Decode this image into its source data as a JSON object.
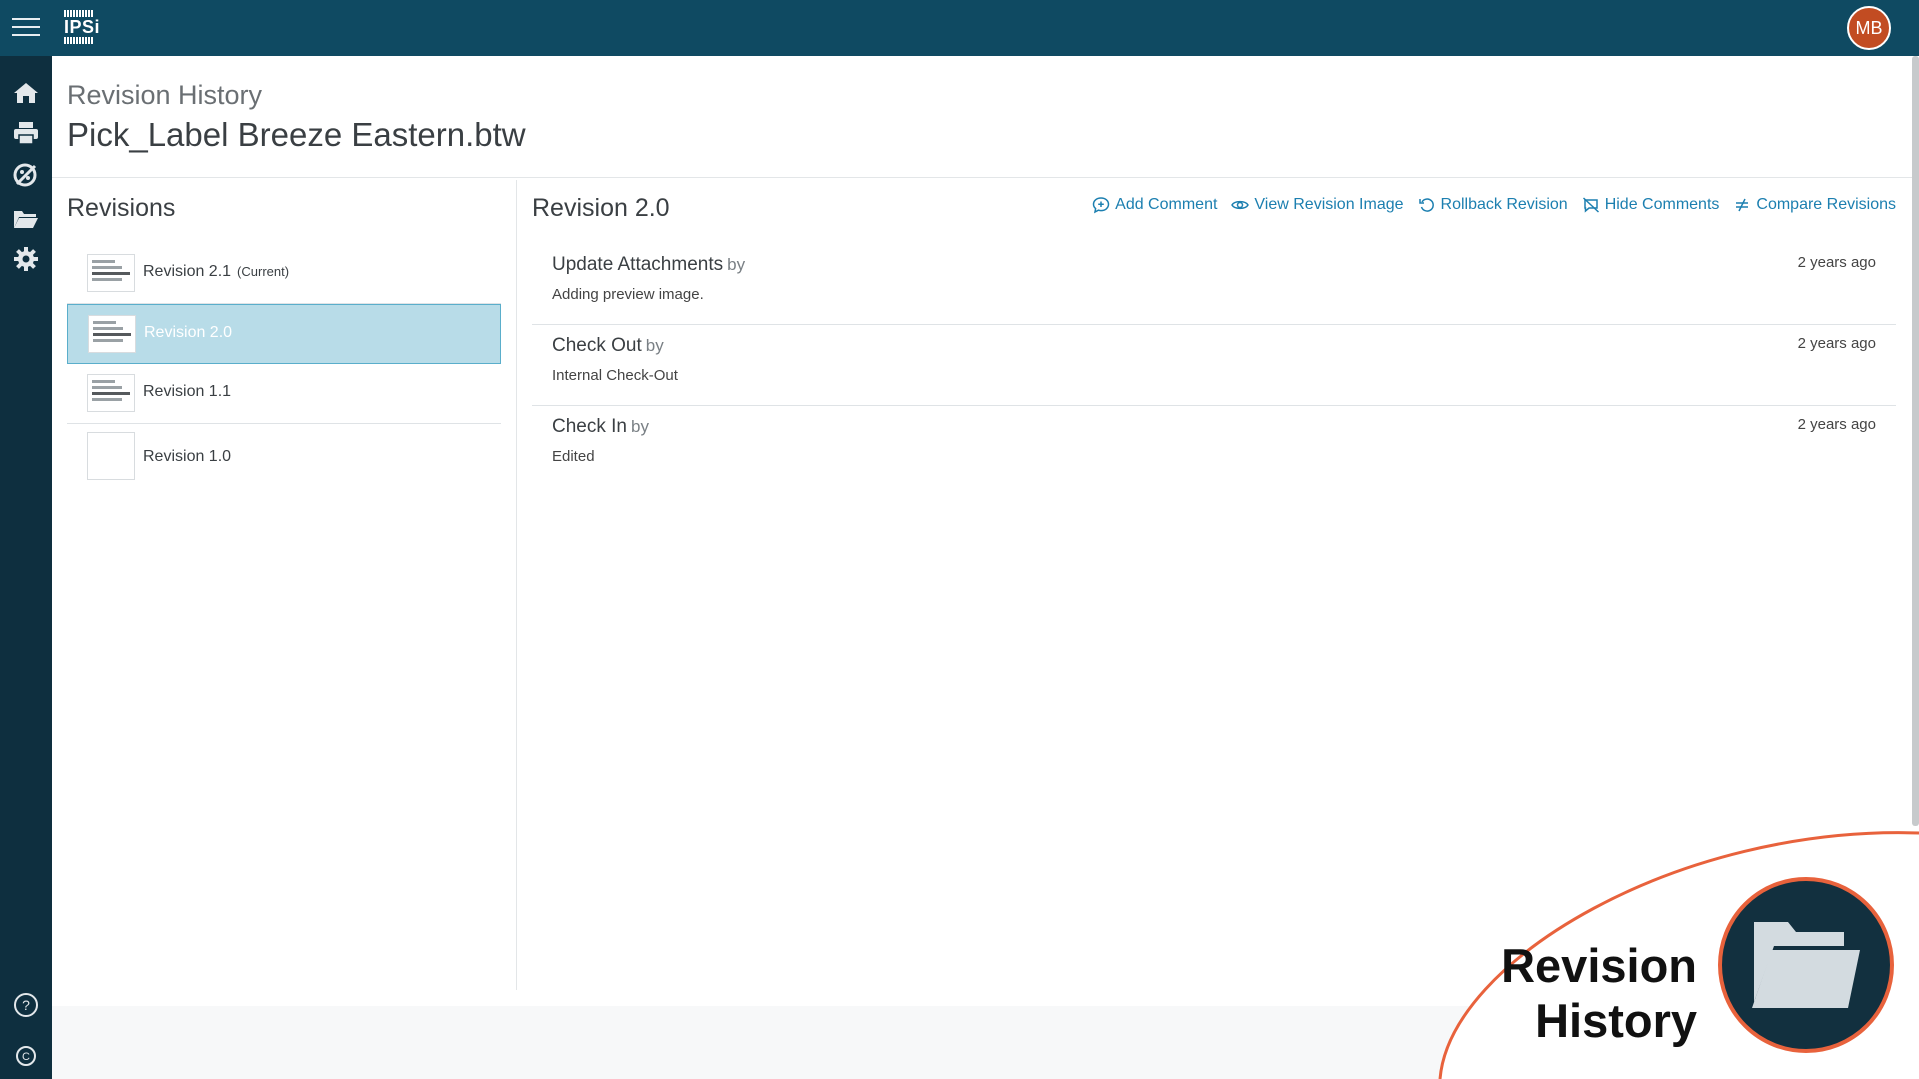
{
  "header": {
    "logo_text": "IPSi",
    "avatar_initials": "MB"
  },
  "sidebar": {
    "icons": [
      "home-icon",
      "printer-icon",
      "design-icon",
      "folder-icon",
      "gear-icon",
      "help-icon",
      "copyright-icon"
    ]
  },
  "page": {
    "subtitle": "Revision History",
    "file_name": "Pick_Label Breeze Eastern.btw"
  },
  "revisions": {
    "heading": "Revisions",
    "items": [
      {
        "label": "Revision 2.1",
        "tag": "(Current)"
      },
      {
        "label": "Revision 2.0",
        "tag": ""
      },
      {
        "label": "Revision 1.1",
        "tag": ""
      },
      {
        "label": "Revision 1.0",
        "tag": ""
      }
    ],
    "selected_index": 1
  },
  "detail": {
    "title": "Revision 2.0",
    "actions": {
      "add_comment": "Add Comment",
      "view_image": "View Revision Image",
      "rollback": "Rollback Revision",
      "hide_comments": "Hide Comments",
      "compare": "Compare Revisions"
    },
    "events": [
      {
        "title": "Update Attachments",
        "by": "by",
        "description": "Adding preview image.",
        "time": "2 years ago"
      },
      {
        "title": "Check Out",
        "by": "by",
        "description": "Internal Check-Out",
        "time": "2 years ago"
      },
      {
        "title": "Check In",
        "by": "by",
        "description": "Edited",
        "time": "2 years ago"
      }
    ]
  },
  "overlay": {
    "line1": "Revision",
    "line2": "History",
    "icon": "folder-icon"
  },
  "colors": {
    "topbar": "#0f4a62",
    "sidebar": "#0e2f3f",
    "accent_link": "#1c7fb0",
    "selected_row": "#b8dce8",
    "avatar": "#c24c22",
    "overlay_arc": "#e8623c",
    "overlay_circle": "#12303f"
  }
}
